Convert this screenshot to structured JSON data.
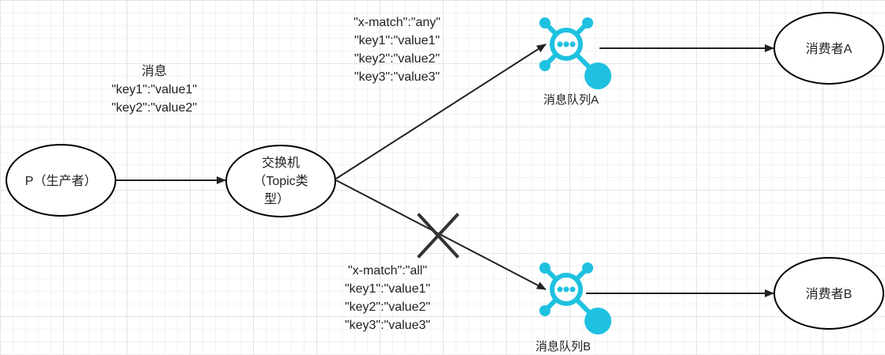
{
  "colors": {
    "line": "#222222",
    "queue_icon": "#1fc1e0",
    "node_fill": "#ffffff",
    "node_stroke": "#000000",
    "grid": "#e3e3e3"
  },
  "producer": {
    "label": "P（生产者）"
  },
  "exchange": {
    "label_line1": "交换机",
    "label_line2": "（Topic类",
    "label_line3": "型）"
  },
  "message": {
    "title": "消息",
    "header1": "\"key1\":\"value1\"",
    "header2": "\"key2\":\"value2\""
  },
  "binding_a": {
    "line1": "\"x-match\":\"any\"",
    "line2": "\"key1\":\"value1\"",
    "line3": "\"key2\":\"value2\"",
    "line4": "\"key3\":\"value3\""
  },
  "binding_b": {
    "line1": "\"x-match\":\"all\"",
    "line2": "\"key1\":\"value1\"",
    "line3": "\"key2\":\"value2\"",
    "line4": "\"key3\":\"value3\""
  },
  "queue_a": {
    "label": "消息队列A",
    "icon": "message-queue-icon"
  },
  "queue_b": {
    "label": "消息队列B",
    "icon": "message-queue-icon"
  },
  "consumer_a": {
    "label": "消费者A"
  },
  "consumer_b": {
    "label": "消费者B"
  },
  "route_b_blocked_icon": "cross-mark-icon"
}
